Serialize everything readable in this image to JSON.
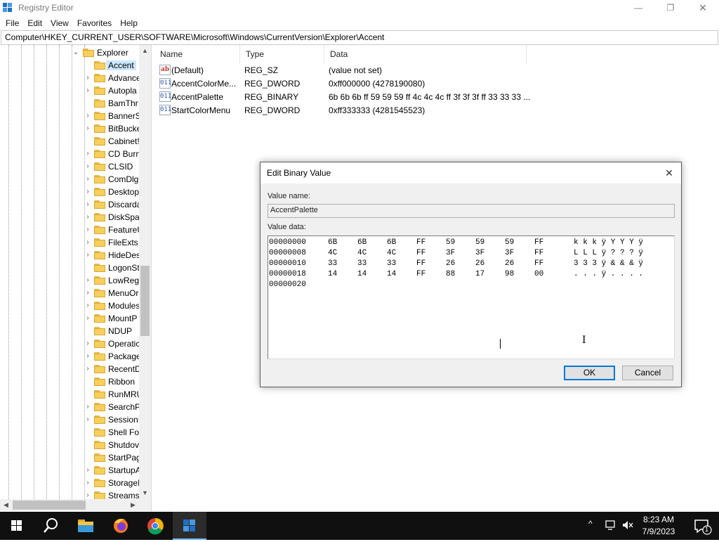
{
  "window": {
    "title": "Registry Editor",
    "minimize_glyph": "—",
    "maximize_glyph": "❐",
    "close_glyph": "✕"
  },
  "menu": [
    "File",
    "Edit",
    "View",
    "Favorites",
    "Help"
  ],
  "address": "Computer\\HKEY_CURRENT_USER\\SOFTWARE\\Microsoft\\Windows\\CurrentVersion\\Explorer\\Accent",
  "tree": {
    "parent": "Explorer",
    "children": [
      {
        "label": "Accent",
        "expandable": false,
        "selected": true
      },
      {
        "label": "Advance",
        "expandable": true
      },
      {
        "label": "Autopla",
        "expandable": true
      },
      {
        "label": "BamThr",
        "expandable": false
      },
      {
        "label": "BannerS",
        "expandable": true
      },
      {
        "label": "BitBucke",
        "expandable": true
      },
      {
        "label": "Cabinet!",
        "expandable": false
      },
      {
        "label": "CD Burn",
        "expandable": true
      },
      {
        "label": "CLSID",
        "expandable": true
      },
      {
        "label": "ComDlg",
        "expandable": true
      },
      {
        "label": "Desktop",
        "expandable": true
      },
      {
        "label": "Discarda",
        "expandable": true
      },
      {
        "label": "DiskSpa",
        "expandable": true
      },
      {
        "label": "FeatureU",
        "expandable": true
      },
      {
        "label": "FileExts",
        "expandable": true
      },
      {
        "label": "HideDes",
        "expandable": true
      },
      {
        "label": "LogonSt",
        "expandable": false
      },
      {
        "label": "LowReg",
        "expandable": true
      },
      {
        "label": "MenuOr",
        "expandable": true
      },
      {
        "label": "Modules",
        "expandable": true
      },
      {
        "label": "MountP",
        "expandable": true
      },
      {
        "label": "NDUP",
        "expandable": false
      },
      {
        "label": "Operatic",
        "expandable": true
      },
      {
        "label": "Package",
        "expandable": true
      },
      {
        "label": "RecentD",
        "expandable": true
      },
      {
        "label": "Ribbon",
        "expandable": false
      },
      {
        "label": "RunMRU",
        "expandable": false
      },
      {
        "label": "SearchP",
        "expandable": true
      },
      {
        "label": "SessionI",
        "expandable": true
      },
      {
        "label": "Shell Fol",
        "expandable": false
      },
      {
        "label": "Shutdov",
        "expandable": false
      },
      {
        "label": "StartPag",
        "expandable": false
      },
      {
        "label": "StartupA",
        "expandable": true
      },
      {
        "label": "StorageI",
        "expandable": true
      },
      {
        "label": "Streams",
        "expandable": true
      }
    ]
  },
  "list": {
    "headers": [
      "Name",
      "Type",
      "Data"
    ],
    "rows": [
      {
        "icon": "ab",
        "icon_kind": "sz",
        "name": "(Default)",
        "type": "REG_SZ",
        "data": "(value not set)"
      },
      {
        "icon": "011",
        "icon_kind": "bin",
        "name": "AccentColorMe...",
        "type": "REG_DWORD",
        "data": "0xff000000 (4278190080)"
      },
      {
        "icon": "011",
        "icon_kind": "bin",
        "name": "AccentPalette",
        "type": "REG_BINARY",
        "data": "6b 6b 6b ff 59 59 59 ff 4c 4c 4c ff 3f 3f 3f ff 33 33 33 ..."
      },
      {
        "icon": "011",
        "icon_kind": "bin",
        "name": "StartColorMenu",
        "type": "REG_DWORD",
        "data": "0xff333333 (4281545523)"
      }
    ]
  },
  "dialog": {
    "title": "Edit Binary Value",
    "close_glyph": "✕",
    "value_name_label": "Value name:",
    "value_name": "AccentPalette",
    "value_data_label": "Value data:",
    "hex_rows": [
      {
        "offset": "00000000",
        "bytes": [
          "6B",
          "6B",
          "6B",
          "FF",
          "59",
          "59",
          "59",
          "FF"
        ],
        "ascii": "k k k ÿ Y Y Y ÿ"
      },
      {
        "offset": "00000008",
        "bytes": [
          "4C",
          "4C",
          "4C",
          "FF",
          "3F",
          "3F",
          "3F",
          "FF"
        ],
        "ascii": "L L L ÿ ? ? ? ÿ"
      },
      {
        "offset": "00000010",
        "bytes": [
          "33",
          "33",
          "33",
          "FF",
          "26",
          "26",
          "26",
          "FF"
        ],
        "ascii": "3 3 3 ÿ & & & ÿ"
      },
      {
        "offset": "00000018",
        "bytes": [
          "14",
          "14",
          "14",
          "FF",
          "88",
          "17",
          "98",
          "00"
        ],
        "ascii": ". . . ÿ . . . ."
      },
      {
        "offset": "00000020",
        "bytes": [],
        "ascii": ""
      }
    ],
    "ok_label": "OK",
    "cancel_label": "Cancel"
  },
  "taskbar": {
    "apps": [
      "start-icon",
      "search-icon",
      "file-explorer-icon",
      "firefox-icon",
      "chrome-icon",
      "registry-editor-icon"
    ],
    "tray_chevron": "^",
    "time": "8:23 AM",
    "date": "7/9/2023",
    "notification_count": "1"
  }
}
